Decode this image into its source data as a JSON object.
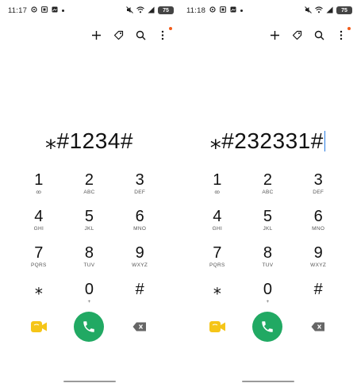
{
  "colors": {
    "call_green": "#21a963",
    "video_yellow": "#f5c518",
    "notification_dot": "#f25c1a",
    "cursor_blue": "#2a7de1"
  },
  "screens": [
    {
      "status": {
        "time": "11:17",
        "battery": "75"
      },
      "dialed": "⁎#1234#",
      "keys": [
        {
          "digit": "1",
          "sub": "ꝏ"
        },
        {
          "digit": "2",
          "sub": "ABC"
        },
        {
          "digit": "3",
          "sub": "DEF"
        },
        {
          "digit": "4",
          "sub": "GHI"
        },
        {
          "digit": "5",
          "sub": "JKL"
        },
        {
          "digit": "6",
          "sub": "MNO"
        },
        {
          "digit": "7",
          "sub": "PQRS"
        },
        {
          "digit": "8",
          "sub": "TUV"
        },
        {
          "digit": "9",
          "sub": "WXYZ"
        },
        {
          "digit": "⁎",
          "sub": ""
        },
        {
          "digit": "0",
          "sub": "+"
        },
        {
          "digit": "#",
          "sub": ""
        }
      ]
    },
    {
      "status": {
        "time": "11:18",
        "battery": "75"
      },
      "dialed": "⁎#232331#",
      "keys": [
        {
          "digit": "1",
          "sub": "ꝏ"
        },
        {
          "digit": "2",
          "sub": "ABC"
        },
        {
          "digit": "3",
          "sub": "DEF"
        },
        {
          "digit": "4",
          "sub": "GHI"
        },
        {
          "digit": "5",
          "sub": "JKL"
        },
        {
          "digit": "6",
          "sub": "MNO"
        },
        {
          "digit": "7",
          "sub": "PQRS"
        },
        {
          "digit": "8",
          "sub": "TUV"
        },
        {
          "digit": "9",
          "sub": "WXYZ"
        },
        {
          "digit": "⁎",
          "sub": ""
        },
        {
          "digit": "0",
          "sub": "+"
        },
        {
          "digit": "#",
          "sub": ""
        }
      ]
    }
  ]
}
